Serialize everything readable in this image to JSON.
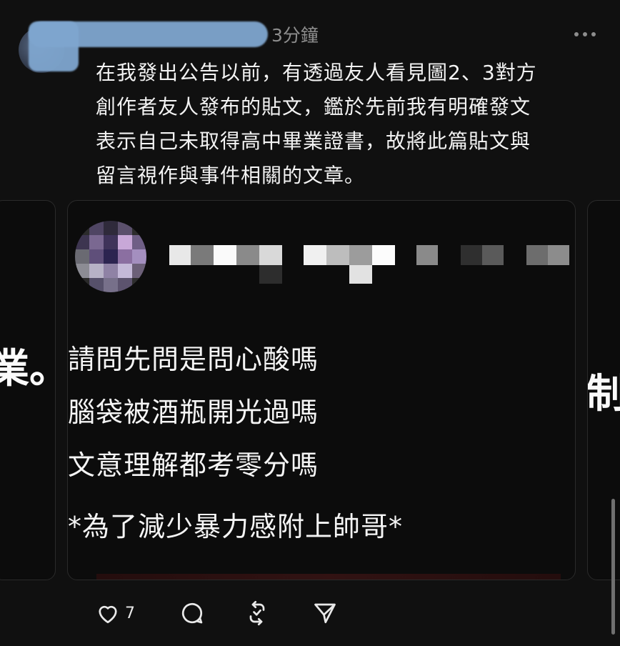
{
  "post": {
    "timestamp": "3分鐘",
    "text": "在我發出公告以前，有透過友人看見圖2、3對方\n創作者友人發布的貼文，鑑於先前我有明確發文\n表示自己未取得高中畢業證書，故將此篇貼文與\n留言視作與事件相關的文章。",
    "more_icon": "more-horizontal-icon"
  },
  "carousel": {
    "left_card_glyph": "業。",
    "right_card_glyph": "制",
    "main_card": {
      "quote_lines": "請問先問是問心酸嗎\n腦袋被酒瓶開光過嗎\n文意理解都考零分嗎",
      "note": "*為了減少暴力感附上帥哥*"
    }
  },
  "actions": {
    "like_count": "7",
    "like_icon": "heart-icon",
    "comment_icon": "comment-icon",
    "repost_icon": "repost-icon",
    "share_icon": "send-icon"
  }
}
